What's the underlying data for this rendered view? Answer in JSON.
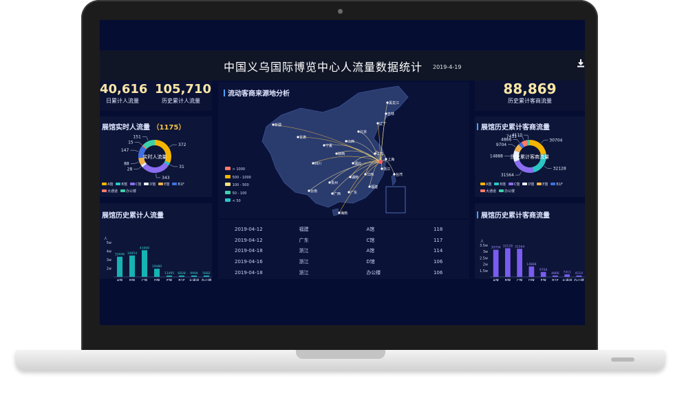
{
  "header": {
    "title": "中国义乌国际博览中心人流量数据统计",
    "date": "2019-4-19"
  },
  "kpis": {
    "daily_total": {
      "value": "40,616",
      "label": "日累计人流量"
    },
    "history_total": {
      "value": "105,710",
      "label": "历史累计人流量"
    },
    "merchant_history": {
      "value": "88,869",
      "label": "历史累计客商流量"
    }
  },
  "panels": {
    "realtime": {
      "title": "展馆实时人流量",
      "count": "（1175）",
      "center": "实时人流量"
    },
    "map": {
      "title": "流动客商来源地分析"
    },
    "merchant_donut": {
      "title": "展馆历史累计客商流量",
      "center": "历史累计客商流量"
    },
    "hall_history": {
      "title": "展馆历史累计人流量"
    },
    "merchant_bars": {
      "title": "展馆历史累计客商流量"
    }
  },
  "legend": {
    "items": [
      {
        "label": "A馆",
        "color": "#f6b500"
      },
      {
        "label": "B馆",
        "color": "#2bc4c4"
      },
      {
        "label": "C馆",
        "color": "#8a6df0"
      },
      {
        "label": "D馆",
        "color": "#e9f0ff"
      },
      {
        "label": "E馆",
        "color": "#f2b04a"
      },
      {
        "label": "B1F",
        "color": "#3f6fe0"
      },
      {
        "label": "大通道",
        "color": "#ff7b6b"
      },
      {
        "label": "办公楼",
        "color": "#3ed1a8"
      }
    ]
  },
  "map_legend": [
    {
      "label": "> 1000",
      "color": "#ff7b6b"
    },
    {
      "label": "500 - 1000",
      "color": "#f6b500"
    },
    {
      "label": "100 - 500",
      "color": "#f5e07a"
    },
    {
      "label": "50 - 100",
      "color": "#3ed1a8"
    },
    {
      "label": "< 50",
      "color": "#2bc4c4"
    }
  ],
  "map_cities": [
    "新疆",
    "黑龙江",
    "吉林",
    "辽宁",
    "北京",
    "宁夏",
    "甘肃",
    "山西",
    "陕西",
    "四川",
    "湖北",
    "江苏",
    "上海",
    "浙江",
    "江西",
    "湖南",
    "贵州",
    "广西",
    "广东",
    "福建",
    "云南",
    "海南",
    "台湾"
  ],
  "table": {
    "rows": [
      [
        "2019-04-12",
        "福建",
        "A馆",
        "118"
      ],
      [
        "2019-04-12",
        "广东",
        "C馆",
        "117"
      ],
      [
        "2019-04-18",
        "浙江",
        "A馆",
        "114"
      ],
      [
        "2019-04-16",
        "浙江",
        "D馆",
        "106"
      ],
      [
        "2019-04-18",
        "浙江",
        "办公楼",
        "106"
      ]
    ]
  },
  "chart_data": [
    {
      "type": "pie",
      "title": "展馆实时人流量",
      "categories": [
        "A馆",
        "B馆",
        "C馆",
        "D馆",
        "E馆",
        "B1F",
        "大通道",
        "办公楼"
      ],
      "values": [
        372,
        31,
        343,
        28,
        88,
        147,
        15,
        151
      ],
      "colors": [
        "#f6b500",
        "#2bc4c4",
        "#8a6df0",
        "#e9f0ff",
        "#f2b04a",
        "#3f6fe0",
        "#ff7b6b",
        "#3ed1a8"
      ]
    },
    {
      "type": "pie",
      "title": "展馆历史累计客商流量",
      "categories": [
        "A馆",
        "B馆",
        "C馆",
        "D馆",
        "E馆",
        "B1F",
        "大通道",
        "办公楼"
      ],
      "values": [
        30704,
        32128,
        31564,
        14888,
        9704,
        4866,
        7411,
        4110
      ],
      "colors": [
        "#f6b500",
        "#2bc4c4",
        "#8a6df0",
        "#e9f0ff",
        "#f2b04a",
        "#3f6fe0",
        "#ff7b6b",
        "#3ed1a8"
      ]
    },
    {
      "type": "bar",
      "title": "展馆历史累计人流量",
      "ylabel": "人",
      "categories": [
        "A馆",
        "B馆",
        "C馆",
        "D馆",
        "E馆",
        "B1F",
        "大通道",
        "办公楼"
      ],
      "values": [
        33446,
        34854,
        41000,
        19480,
        11495,
        6828,
        9994,
        5682
      ],
      "y_ticks": [
        "2w",
        "3w",
        "4w",
        "5w"
      ],
      "ylim": [
        10000,
        50000
      ],
      "color": "#17b3b3"
    },
    {
      "type": "bar",
      "title": "展馆历史累计客商流量",
      "ylabel": "人",
      "categories": [
        "A馆",
        "B馆",
        "C馆",
        "D馆",
        "E馆",
        "B1F",
        "大通道",
        "办公楼"
      ],
      "values": [
        30704,
        32128,
        31564,
        14888,
        9704,
        4866,
        7411,
        4110
      ],
      "y_ticks": [
        "1.5w",
        "2w",
        "2.5w",
        "3w",
        "3.5w"
      ],
      "ylim": [
        5000,
        35000
      ],
      "color": "#7a5cf0"
    }
  ]
}
